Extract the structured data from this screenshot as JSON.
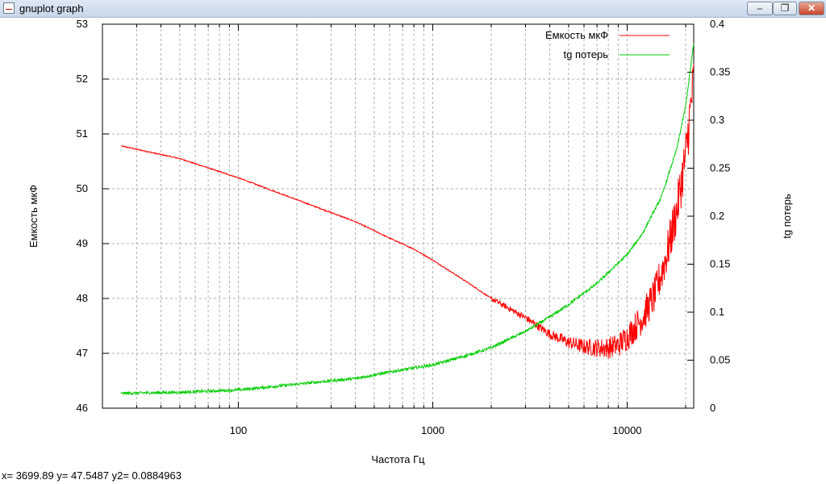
{
  "window": {
    "title": "gnuplot graph",
    "minimize_label": "–",
    "maximize_label": "❐",
    "close_label": "✕"
  },
  "status": {
    "coords": "x= 3699.89 y= 47.5487 y2= 0.0884963"
  },
  "chart_data": {
    "type": "line",
    "title": "",
    "xlabel": "Частота Гц",
    "ylabel": "Емкость мкФ",
    "y2label": "tg потерь",
    "xscale": "log",
    "xlim": [
      20,
      22000
    ],
    "ylim": [
      46,
      53
    ],
    "y2lim": [
      0,
      0.4
    ],
    "xticks": [
      100,
      1000,
      10000
    ],
    "xtick_labels": [
      "100",
      "1000",
      "10000"
    ],
    "yticks": [
      46,
      47,
      48,
      49,
      50,
      51,
      52,
      53
    ],
    "ytick_labels": [
      "46",
      "47",
      "48",
      "49",
      "50",
      "51",
      "52",
      "53"
    ],
    "y2ticks": [
      0,
      0.05,
      0.1,
      0.15,
      0.2,
      0.25,
      0.3,
      0.35,
      0.4
    ],
    "y2tick_labels": [
      "0",
      "0.05",
      "0.1",
      "0.15",
      "0.2",
      "0.25",
      "0.3",
      "0.35",
      "0.4"
    ],
    "grid": true,
    "legend_position": "top-right",
    "series": [
      {
        "name": "Емкость мкФ",
        "axis": "y",
        "color": "#ff0000",
        "x": [
          25,
          50,
          100,
          200,
          400,
          600,
          800,
          1000,
          1500,
          2000,
          3000,
          4000,
          5000,
          6000,
          7000,
          8000,
          9000,
          10000,
          12000,
          14000,
          16000,
          18000,
          20000,
          22000
        ],
        "y": [
          50.78,
          50.55,
          50.2,
          49.8,
          49.4,
          49.1,
          48.9,
          48.7,
          48.3,
          48.0,
          47.65,
          47.35,
          47.2,
          47.12,
          47.1,
          47.1,
          47.15,
          47.3,
          47.65,
          48.1,
          48.8,
          49.6,
          50.6,
          52.0
        ]
      },
      {
        "name": "tg потерь",
        "axis": "y2",
        "color": "#00cc00",
        "x": [
          25,
          50,
          100,
          200,
          400,
          700,
          1000,
          1500,
          2000,
          3000,
          4000,
          5000,
          7000,
          10000,
          12000,
          15000,
          18000,
          20000,
          22000
        ],
        "y": [
          0.0155,
          0.0165,
          0.019,
          0.025,
          0.031,
          0.04,
          0.045,
          0.055,
          0.063,
          0.08,
          0.095,
          0.108,
          0.13,
          0.16,
          0.182,
          0.22,
          0.27,
          0.315,
          0.38
        ]
      }
    ]
  }
}
